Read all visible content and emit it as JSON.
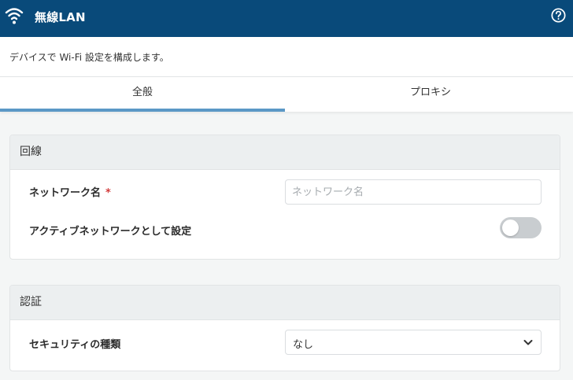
{
  "header": {
    "title": "無線LAN",
    "icon": "wifi-icon",
    "help_icon": "help-circle-icon",
    "background": "#094a7a"
  },
  "description": "デバイスで Wi-Fi 設定を構成します。",
  "tabs": [
    {
      "label": "全般",
      "active": true
    },
    {
      "label": "プロキシ",
      "active": false
    }
  ],
  "accent": "#5b98c6",
  "sections": {
    "line": {
      "title": "回線",
      "network_name": {
        "label": "ネットワーク名",
        "required_mark": "*",
        "value": "",
        "placeholder": "ネットワーク名"
      },
      "active_network": {
        "label": "アクティブネットワークとして設定",
        "enabled": false
      }
    },
    "auth": {
      "title": "認証",
      "security_type": {
        "label": "セキュリティの種類",
        "selected": "なし"
      }
    }
  }
}
